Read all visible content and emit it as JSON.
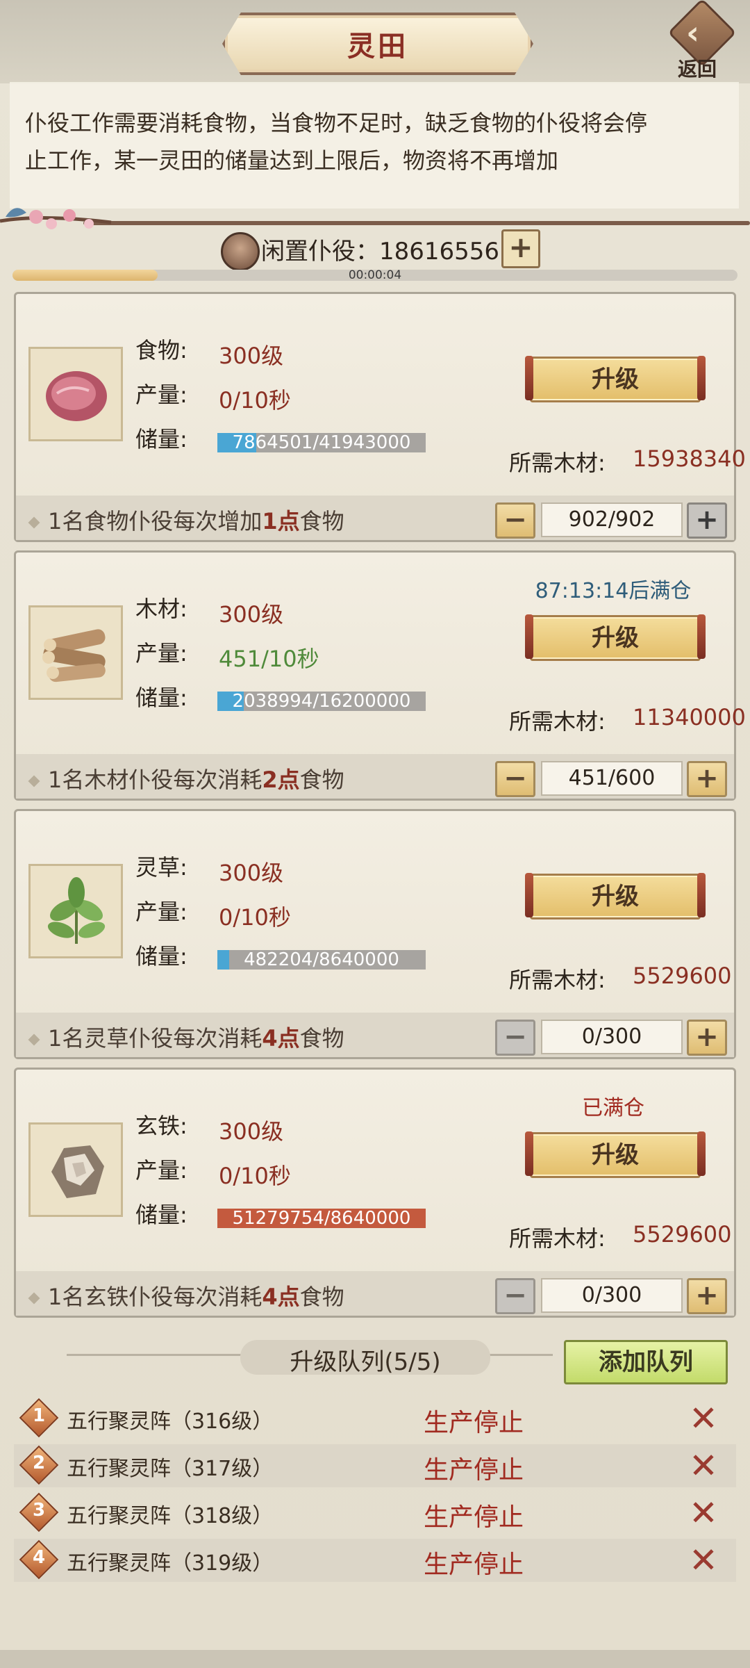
{
  "header": {
    "title": "灵田",
    "back_label": "返回"
  },
  "description": {
    "line1": "仆役工作需要消耗食物，当食物不足时，缺乏食物的仆役将会停",
    "line2": "止工作，某一灵田的储量达到上限后，物资将不再增加"
  },
  "idle": {
    "label": "闲置仆役：18616556",
    "plus": "+",
    "timer": "00:00:04",
    "timer_progress": 0.2
  },
  "fields": [
    {
      "name_label": "食物:",
      "level": "300级",
      "production_label": "产量:",
      "production": "0/10秒",
      "storage_label": "储量:",
      "storage": "7864501/41943000",
      "storage_fraction": 0.188,
      "storage_color": "#4aa6d4",
      "notice": "",
      "upgrade_label": "升级",
      "wood_label": "所需木材:",
      "wood_cost": "15938340",
      "footer_prefix": "1名食物仆役每次增加",
      "footer_num": "1点",
      "footer_suffix": "食物",
      "minus": "−",
      "count": "902/902",
      "plus": "+"
    },
    {
      "name_label": "木材:",
      "level": "300级",
      "production_label": "产量:",
      "production": "451/10秒",
      "storage_label": "储量:",
      "storage": "2038994/16200000",
      "storage_fraction": 0.126,
      "storage_color": "#4aa6d4",
      "notice": "87:13:14后满仓",
      "upgrade_label": "升级",
      "wood_label": "所需木材:",
      "wood_cost": "11340000",
      "footer_prefix": "1名木材仆役每次消耗",
      "footer_num": "2点",
      "footer_suffix": "食物",
      "minus": "−",
      "count": "451/600",
      "plus": "+"
    },
    {
      "name_label": "灵草:",
      "level": "300级",
      "production_label": "产量:",
      "production": "0/10秒",
      "storage_label": "储量:",
      "storage": "482204/8640000",
      "storage_fraction": 0.056,
      "storage_color": "#4aa6d4",
      "notice": "",
      "upgrade_label": "升级",
      "wood_label": "所需木材:",
      "wood_cost": "5529600",
      "footer_prefix": "1名灵草仆役每次消耗",
      "footer_num": "4点",
      "footer_suffix": "食物",
      "minus": "−",
      "count": "0/300",
      "plus": "+"
    },
    {
      "name_label": "玄铁:",
      "level": "300级",
      "production_label": "产量:",
      "production": "0/10秒",
      "storage_label": "储量:",
      "storage": "51279754/8640000",
      "storage_fraction": 1.0,
      "storage_color": "#c45a3e",
      "notice": "已满仓",
      "upgrade_label": "升级",
      "wood_label": "所需木材:",
      "wood_cost": "5529600",
      "footer_prefix": "1名玄铁仆役每次消耗",
      "footer_num": "4点",
      "footer_suffix": "食物",
      "minus": "−",
      "count": "0/300",
      "plus": "+"
    }
  ],
  "queue": {
    "title": "升级队列(5/5)",
    "add_label": "添加队列",
    "items": [
      {
        "num": "1",
        "name": "五行聚灵阵（316级）",
        "status": "生产停止",
        "cancel": "✕"
      },
      {
        "num": "2",
        "name": "五行聚灵阵（317级）",
        "status": "生产停止",
        "cancel": "✕"
      },
      {
        "num": "3",
        "name": "五行聚灵阵（318级）",
        "status": "生产停止",
        "cancel": "✕"
      },
      {
        "num": "4",
        "name": "五行聚灵阵（319级）",
        "status": "生产停止",
        "cancel": "✕"
      }
    ]
  },
  "icons": [
    "back-arrow-icon",
    "servant-avatar-icon",
    "meat-icon",
    "wood-logs-icon",
    "herb-icon",
    "iron-ore-icon",
    "plum-branch-icon",
    "diamond-badge-icon",
    "cancel-x-icon"
  ]
}
